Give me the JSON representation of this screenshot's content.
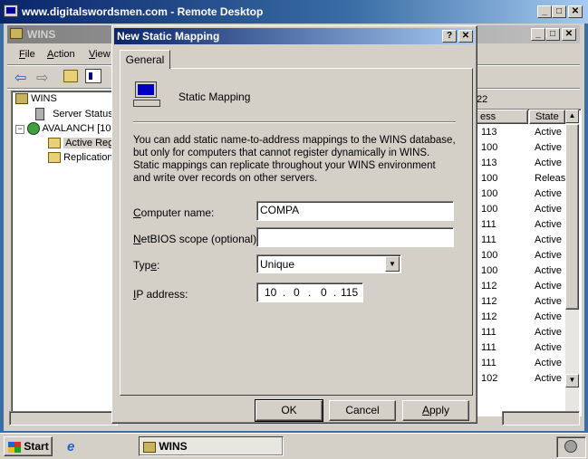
{
  "remote_title": "www.digitalswordsmen.com - Remote Desktop",
  "wins_title": "WINS",
  "menu": [
    {
      "label": "File",
      "u": "F",
      "rest": "ile"
    },
    {
      "label": "Action",
      "u": "A",
      "rest": "ction"
    },
    {
      "label": "View",
      "u": "V",
      "rest": "iew"
    }
  ],
  "tree": {
    "root": "WINS",
    "server_status": "Server Status",
    "server": "AVALANCH [10",
    "active_reg": "Active Reg",
    "replication": "Replication"
  },
  "list": {
    "count_fragment": "22",
    "col_address": "ess",
    "col_state": "State",
    "rows": [
      {
        "addr": "113",
        "state": "Active"
      },
      {
        "addr": "100",
        "state": "Active"
      },
      {
        "addr": "113",
        "state": "Active"
      },
      {
        "addr": "100",
        "state": "Releas"
      },
      {
        "addr": "100",
        "state": "Active"
      },
      {
        "addr": "100",
        "state": "Active"
      },
      {
        "addr": "111",
        "state": "Active"
      },
      {
        "addr": "111",
        "state": "Active"
      },
      {
        "addr": "100",
        "state": "Active"
      },
      {
        "addr": "100",
        "state": "Active"
      },
      {
        "addr": "112",
        "state": "Active"
      },
      {
        "addr": "112",
        "state": "Active"
      },
      {
        "addr": "112",
        "state": "Active"
      },
      {
        "addr": "111",
        "state": "Active"
      },
      {
        "addr": "111",
        "state": "Active"
      },
      {
        "addr": "111",
        "state": "Active"
      },
      {
        "addr": "102",
        "state": "Active"
      }
    ]
  },
  "dialog": {
    "title": "New Static Mapping",
    "help": "?",
    "close": "✕",
    "tab": "General",
    "heading": "Static Mapping",
    "description": "You can add static name-to-address mappings to the WINS database, but only for computers that cannot register dynamically in WINS. Static mappings can replicate throughout your WINS environment and write over records on other servers.",
    "computer_name_label_u": "C",
    "computer_name_label_rest": "omputer name:",
    "computer_name_value": "COMPA",
    "netbios_label_u": "N",
    "netbios_label_rest": "etBIOS scope (optional):",
    "netbios_value": "",
    "type_label_pre": "Typ",
    "type_label_u": "e",
    "type_label_rest": ":",
    "type_value": "Unique",
    "ip_label_u": "I",
    "ip_label_rest": "P address:",
    "ip_octets": [
      "10",
      "0",
      "0",
      "115"
    ],
    "ok": "OK",
    "cancel": "Cancel",
    "apply_u": "A",
    "apply_rest": "pply"
  },
  "taskbar": {
    "start": "Start",
    "task": "WINS"
  }
}
